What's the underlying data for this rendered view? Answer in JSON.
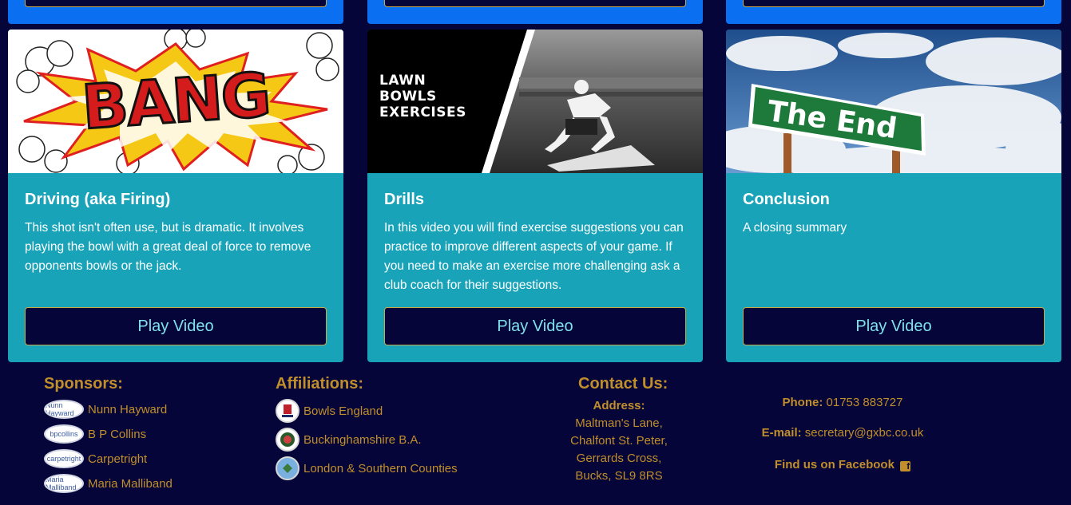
{
  "cards": [
    {
      "title": "Driving (aka Firing)",
      "description": "This shot isn't often use, but is dramatic. It involves playing the bowl with a great deal of force to remove opponents bowls or the jack.",
      "button": "Play Video",
      "image_text": "BANG"
    },
    {
      "title": "Drills",
      "description": "In this video you will find exercise suggestions you can practice to improve different aspects of your game. If you need to make an exercise more challenging ask a club coach for their suggestions.",
      "button": "Play Video",
      "image_text": [
        "LAWN",
        "BOWLS",
        "EXERCISES"
      ]
    },
    {
      "title": "Conclusion",
      "description": "A closing summary",
      "button": "Play Video",
      "image_text": "The End"
    }
  ],
  "footer": {
    "sponsors": {
      "heading": "Sponsors:",
      "items": [
        "Nunn Hayward",
        "B P Collins",
        "Carpetright",
        "Maria Malliband"
      ],
      "logo_text": [
        "Nunn Hayward",
        "bpcollins",
        "carpetright",
        "Maria Malliband"
      ]
    },
    "affiliations": {
      "heading": "Affiliations:",
      "items": [
        "Bowls England",
        "Buckinghamshire B.A.",
        "London & Southern Counties"
      ]
    },
    "contact": {
      "heading": "Contact Us:",
      "address_label": "Address:",
      "address_lines": [
        "Maltman's Lane,",
        "Chalfont St. Peter,",
        "Gerrards Cross,",
        "Bucks, SL9 8RS"
      ],
      "phone_label": "Phone:",
      "phone": "01753 883727",
      "email_label": "E-mail:",
      "email": "secretary@gxbc.co.uk",
      "facebook": "Find us on Facebook"
    }
  },
  "colors": {
    "background": "#05053a",
    "card": "#18a3b9",
    "top_card": "#0a6ff0",
    "button_text": "#7fe1ec",
    "footer_text": "#c08e2a"
  }
}
